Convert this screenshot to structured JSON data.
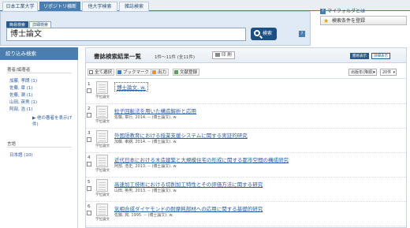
{
  "tabs": [
    {
      "label": "日本工業大学"
    },
    {
      "label": "リポジトリ横断"
    },
    {
      "label": "他大学検索"
    },
    {
      "label": "雑誌検索"
    }
  ],
  "search": {
    "mode_simple": "簡易検索",
    "mode_detail": "詳細検索",
    "query": "博士論文",
    "button_label": "検索"
  },
  "utility": {
    "myfolder_label": "マイフォルダとは",
    "saved_conditions_label": "検索条件を登録"
  },
  "sidebar": {
    "heading": "絞り込み検索",
    "author_section": "著者/編著者",
    "authors": [
      "加藤, 孝朗 (1)",
      "佐藤, 章 (1)",
      "佐藤, 潤 (1)",
      "山田, 英男 (1)",
      "阿部, 浩 (1)"
    ],
    "more_label": "▶ 他の著者を表示(7件)",
    "language_section": "言語",
    "languages": [
      "日本語 (10)"
    ]
  },
  "results": {
    "heading": "書誌検索結果一覧",
    "count": "1件〜11件 (全11件)",
    "print_label": "印 刷",
    "display_simple": "簡易表示",
    "display_detail": "詳細表示",
    "toolbar": {
      "select_all": "全て選択",
      "bookmark": "ブックマーク",
      "output": "出力",
      "register": "文献登録"
    },
    "sort_value": "出版年(降順)",
    "per_page_value": "20件",
    "items": [
      {
        "num": "1",
        "title": "博士論文. w.",
        "meta": "",
        "type": "学位論文"
      },
      {
        "num": "2",
        "title": "粒子回転法を用いた構造解析と応用",
        "meta": "佐藤, 章行, 2014. -- (博士論文). w.",
        "type": "学位論文"
      },
      {
        "num": "3",
        "title": "外国語教育における授業支援システムに関する実証的研究",
        "meta": "加藤, 孝朗, 2014. -- (博士論文). w.",
        "type": "学位論文"
      },
      {
        "num": "4",
        "title": "近代日本における木造建築と大規模住宅の形成に関する都市空間の構成研究",
        "meta": "阿部, 浩史, 2013. -- (博士論文). w.",
        "type": "学位論文"
      },
      {
        "num": "5",
        "title": "高速加工技術における切削加工特性とその評価方法に関する研究",
        "meta": "山田, 英男, 2013. -- (博士論文). w.",
        "type": "学位論文"
      },
      {
        "num": "6",
        "title": "気相合成ダイヤモンドの耐摩耗部材への応用に関する基礎的研究",
        "meta": "佐藤, 潤, 1995. -- (博士論文). w.",
        "type": "学位論文"
      }
    ]
  }
}
